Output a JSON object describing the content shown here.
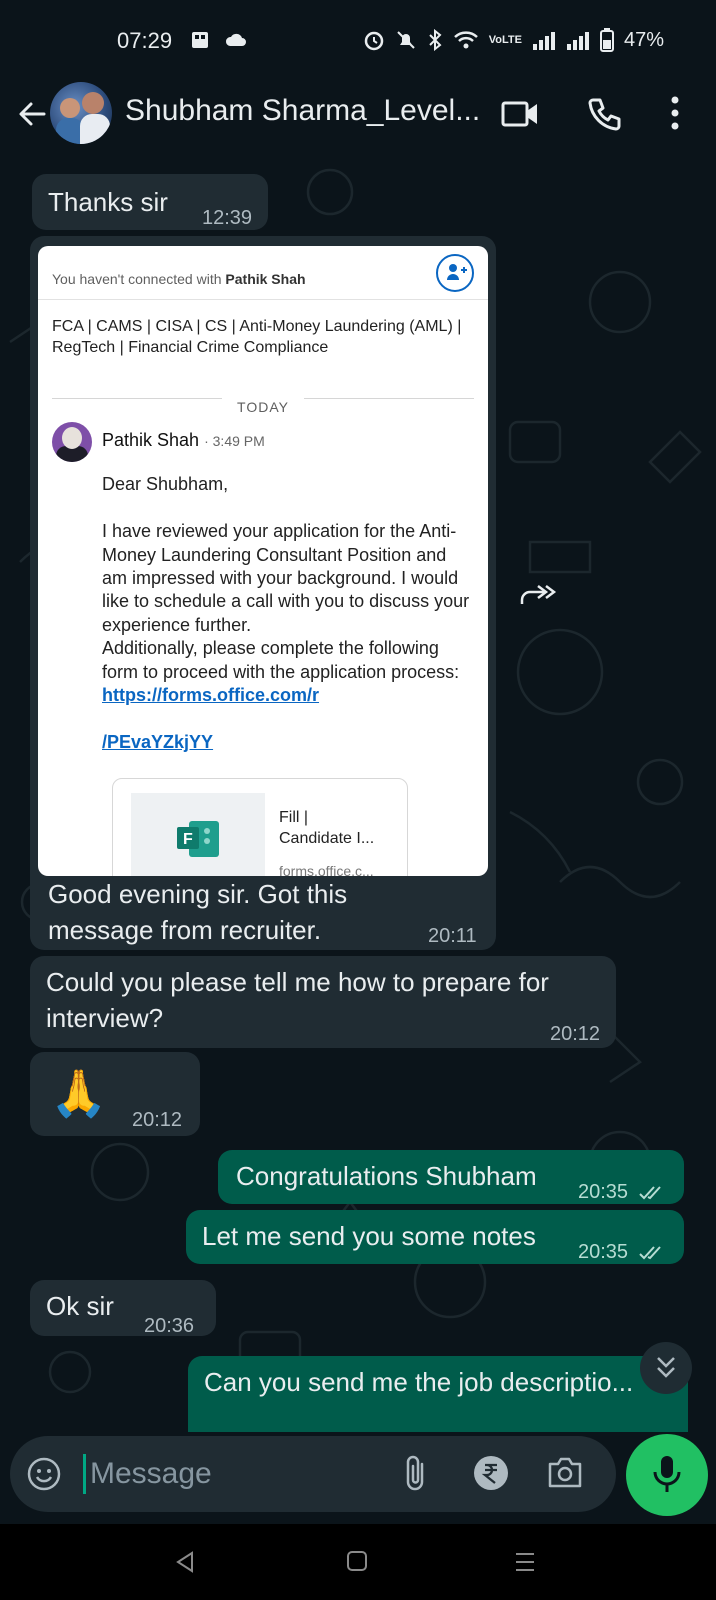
{
  "status_bar": {
    "time": "07:29",
    "battery": "47%",
    "network_label": "VoLTE"
  },
  "header": {
    "contact_name": "Shubham Sharma_Level...",
    "icons": [
      "back-arrow-icon",
      "video-call-icon",
      "phone-icon",
      "more-vert-icon"
    ]
  },
  "messages": [
    {
      "dir": "in",
      "text": "Thanks sir",
      "time": "12:39"
    },
    {
      "dir": "in",
      "type": "image",
      "screenshot": {
        "banner_prefix": "You haven't connected with ",
        "banner_name": "Pathik Shah",
        "headline": "FCA | CAMS | CISA | CS | Anti-Money Laundering (AML) | RegTech | Financial Crime Compliance",
        "today_label": "TODAY",
        "sender": "Pathik Shah",
        "sender_time": "· 3:49 PM",
        "body": "Dear Shubham,\n\nI have reviewed your application for the Anti-Money Laundering Consultant Position and am impressed with your background. I would like to schedule a call with you to discuss your experience further.\nAdditionally, please complete the following form to proceed with the application process:",
        "link_line1": "https://forms.office.com/r",
        "link_line2": "/PEvaYZkjYY",
        "card_title_line1": "Fill |",
        "card_title_line2": "Candidate I...",
        "card_domain": "forms.office.c..."
      },
      "caption": "Good evening sir. Got this message from recruiter.",
      "caption_line1": "Good evening sir. Got this",
      "caption_line2": "message from recruiter.",
      "time": "20:11"
    },
    {
      "dir": "in",
      "text": "Could you please tell me how to prepare for interview?",
      "text_line1": "Could you please tell me how to prepare for",
      "text_line2": "interview?",
      "time": "20:12"
    },
    {
      "dir": "in",
      "text": "🙏",
      "time": "20:12"
    },
    {
      "dir": "out",
      "text": "Congratulations Shubham",
      "time": "20:35",
      "status": "read"
    },
    {
      "dir": "out",
      "text": "Let me send you some notes",
      "time": "20:35",
      "status": "read"
    },
    {
      "dir": "in",
      "text": "Ok sir",
      "time": "20:36"
    },
    {
      "dir": "out",
      "text": "Can you send me the job descriptio...",
      "partial": true
    }
  ],
  "composer": {
    "placeholder": "Message"
  },
  "colors": {
    "background": "#0b141a",
    "incoming_bubble": "#202c33",
    "outgoing_bubble": "#005c4b",
    "accent": "#21c063",
    "link": "#0a66c2"
  }
}
